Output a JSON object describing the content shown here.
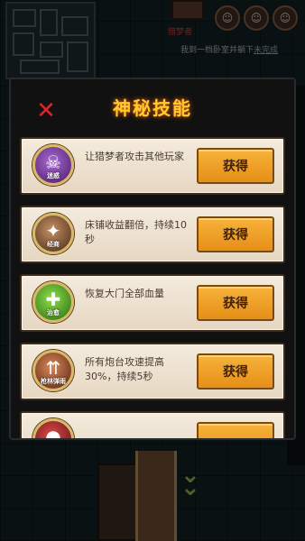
{
  "scene": {
    "player_name": "猎梦者",
    "hint_prefix": "我到一档卧室并躺下",
    "hint_link": "未完成",
    "avatar_glyphs": [
      "☺",
      "☺",
      "☺"
    ]
  },
  "popup": {
    "title": "神秘技能",
    "close_symbol": "✕",
    "skills": [
      {
        "icon": "monster-icon",
        "glyph": "☠",
        "tag": "迷惑",
        "color_class": "icon-purple",
        "desc": "让猎梦者攻击其他玩家",
        "button": "获得"
      },
      {
        "icon": "coin-icon",
        "glyph": "✦",
        "tag": "经商",
        "color_class": "icon-brown",
        "desc": "床铺收益翻倍，持续10秒",
        "button": "获得"
      },
      {
        "icon": "heal-icon",
        "glyph": "✚",
        "tag": "治愈",
        "color_class": "icon-green",
        "desc": "恢复大门全部血量",
        "button": "获得"
      },
      {
        "icon": "bullets-icon",
        "glyph": "⇈",
        "tag": "枪林弹雨",
        "color_class": "icon-copper",
        "desc": "所有炮台攻速提高30%，持续5秒",
        "button": "获得"
      },
      {
        "icon": "skill-icon",
        "glyph": "●",
        "tag": "",
        "color_class": "icon-red",
        "desc": "",
        "button": ""
      }
    ]
  },
  "colors": {
    "title": "#ffcc2a",
    "button": "#f7b23a",
    "close": "#e02424",
    "card": "#f4ebde"
  }
}
